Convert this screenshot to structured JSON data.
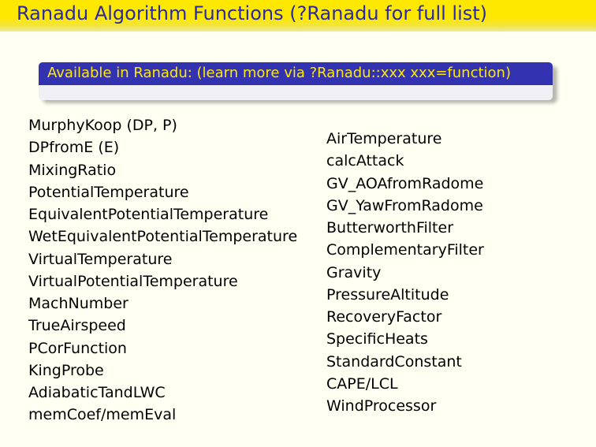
{
  "slide": {
    "title": "Ranadu Algorithm Functions (?Ranadu for full list)"
  },
  "block": {
    "header": "Available in Ranadu: (learn more via ?Ranadu::xxx xxx=function)"
  },
  "left_column": [
    "MurphyKoop (DP, P)",
    "DPfromE (E)",
    "MixingRatio",
    "PotentialTemperature",
    "EquivalentPotentialTemperature",
    "WetEquivalentPotentialTemperature",
    "VirtualTemperature",
    "VirtualPotentialTemperature",
    "MachNumber",
    "TrueAirspeed",
    "PCorFunction",
    "KingProbe",
    "AdiabaticTandLWC",
    "memCoef/memEval"
  ],
  "right_column": [
    "AirTemperature",
    "calcAttack",
    "GV_AOAfromRadome",
    "GV_YawFromRadome",
    "ButterworthFilter",
    "ComplementaryFilter",
    "Gravity",
    "PressureAltitude",
    "RecoveryFactor",
    "SpecificHeats",
    "StandardConstant",
    "CAPE/LCL",
    "WindProcessor"
  ]
}
